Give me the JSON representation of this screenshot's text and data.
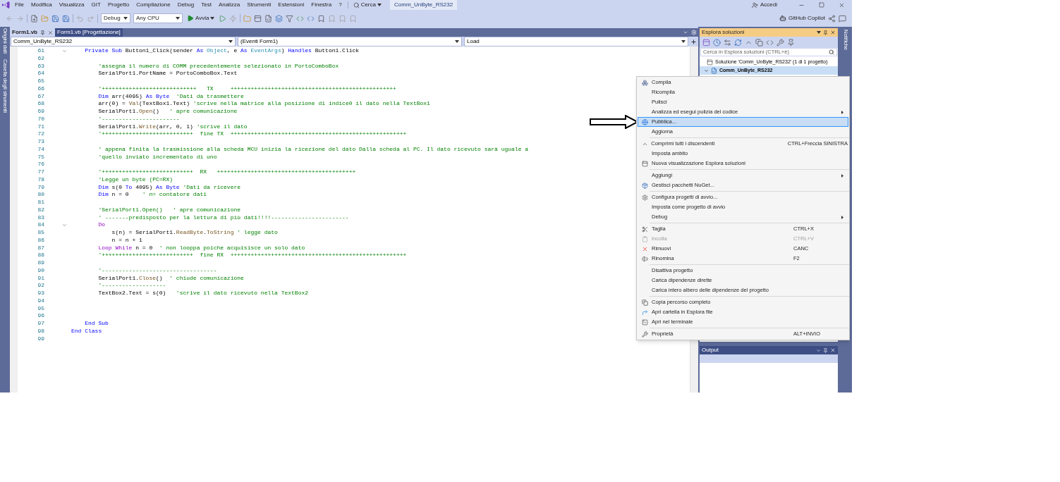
{
  "menu_bar": {
    "items": [
      "File",
      "Modifica",
      "Visualizza",
      "GIT",
      "Progetto",
      "Compilazione",
      "Debug",
      "Test",
      "Analizza",
      "Strumenti",
      "Estensioni",
      "Finestra",
      "?"
    ],
    "search": "Cerca",
    "title": "Comm_UnByte_RS232",
    "account": "Accedi"
  },
  "toolbar": {
    "configuration": "Debug",
    "platform": "Any CPU",
    "start": "Avvia",
    "copilot": "GitHub Copilot"
  },
  "side_tabs_left": [
    "Origini dati",
    "Casella degli strumenti"
  ],
  "side_tabs_right": [
    "Notifiche"
  ],
  "editor": {
    "tabs": [
      {
        "label": "Form1.vb",
        "selected": true
      },
      {
        "label": "Form1.vb [Progettazione]",
        "selected": false
      }
    ],
    "nav": {
      "project": "Comm_UnByte_RS232",
      "object": "(Eventi Form1)",
      "event": "Load"
    },
    "lines": [
      {
        "number": "61",
        "fold": true,
        "tokens": [
          {
            "kind": "keyword",
            "text": "    Private Sub "
          },
          {
            "kind": "plain",
            "text": "Button1_Click(sender "
          },
          {
            "kind": "keyword",
            "text": "As "
          },
          {
            "kind": "type",
            "text": "Object"
          },
          {
            "kind": "plain",
            "text": ", e "
          },
          {
            "kind": "keyword",
            "text": "As "
          },
          {
            "kind": "type",
            "text": "EventArgs"
          },
          {
            "kind": "plain",
            "text": ") "
          },
          {
            "kind": "keyword",
            "text": "Handles "
          },
          {
            "kind": "plain",
            "text": "Button1.Click"
          }
        ]
      },
      {
        "number": "62",
        "fold": false
      },
      {
        "number": "63",
        "fold": false,
        "tokens": [
          {
            "kind": "comment",
            "text": "        'assegna il numero di COMM precedentemente selezionato in PortoComboBox"
          }
        ]
      },
      {
        "number": "64",
        "fold": false,
        "tokens": [
          {
            "kind": "plain",
            "text": "        SerialPort1.PortName = PortoComboBox.Text"
          }
        ]
      },
      {
        "number": "65",
        "fold": false
      },
      {
        "number": "66",
        "fold": false,
        "tokens": [
          {
            "kind": "comment",
            "text": "        '++++++++++++++++++++++++++++   TX     +++++++++++++++++++++++++++++++++++++++++++++++++"
          }
        ]
      },
      {
        "number": "67",
        "fold": false,
        "tokens": [
          {
            "kind": "keyword",
            "text": "        Dim "
          },
          {
            "kind": "plain",
            "text": "arr(4095) "
          },
          {
            "kind": "keyword",
            "text": "As Byte "
          },
          {
            "kind": "comment",
            "text": " 'Dati da trasmettere"
          }
        ]
      },
      {
        "number": "68",
        "fold": false,
        "tokens": [
          {
            "kind": "plain",
            "text": "        arr(0) = "
          },
          {
            "kind": "method",
            "text": "Val"
          },
          {
            "kind": "plain",
            "text": "(TextBox1.Text) "
          },
          {
            "kind": "comment",
            "text": "'scrive nella matrice alla posizione di indice0 il dato nella TextBox1"
          }
        ]
      },
      {
        "number": "69",
        "fold": false,
        "tokens": [
          {
            "kind": "plain",
            "text": "        SerialPort1."
          },
          {
            "kind": "method",
            "text": "Open"
          },
          {
            "kind": "plain",
            "text": "()   "
          },
          {
            "kind": "comment",
            "text": "' apre comunicazione"
          }
        ]
      },
      {
        "number": "70",
        "fold": false,
        "tokens": [
          {
            "kind": "comment",
            "text": "        '-----------------------"
          }
        ]
      },
      {
        "number": "71",
        "fold": false,
        "tokens": [
          {
            "kind": "plain",
            "text": "        SerialPort1."
          },
          {
            "kind": "method",
            "text": "Write"
          },
          {
            "kind": "plain",
            "text": "(arr, 0, 1) "
          },
          {
            "kind": "comment",
            "text": "'scrive il dato"
          }
        ]
      },
      {
        "number": "72",
        "fold": false,
        "tokens": [
          {
            "kind": "comment",
            "text": "        '+++++++++++++++++++++++++++  fine TX  ++++++++++++++++++++++++++++++++++++++++++++++++++++"
          }
        ]
      },
      {
        "number": "73",
        "fold": false
      },
      {
        "number": "74",
        "fold": false,
        "tokens": [
          {
            "kind": "comment",
            "text": "        ' appena finita la trasmissione alla scheda MCU inizia la ricezione del dato Dalla scheda al PC. Il dato ricevuto sarà uguale a"
          }
        ]
      },
      {
        "number": "75",
        "fold": false,
        "tokens": [
          {
            "kind": "comment",
            "text": "        'quello inviato incrementato di uno"
          }
        ]
      },
      {
        "number": "76",
        "fold": false
      },
      {
        "number": "77",
        "fold": false,
        "tokens": [
          {
            "kind": "comment",
            "text": "        '+++++++++++++++++++++++++++  RX   +++++++++++++++++++++++++++++++++++++++++"
          }
        ]
      },
      {
        "number": "78",
        "fold": false,
        "tokens": [
          {
            "kind": "comment",
            "text": "        'Legge un byte (PC=RX)"
          }
        ]
      },
      {
        "number": "79",
        "fold": false,
        "tokens": [
          {
            "kind": "keyword",
            "text": "        Dim "
          },
          {
            "kind": "plain",
            "text": "s(0 "
          },
          {
            "kind": "keyword",
            "text": "To "
          },
          {
            "kind": "plain",
            "text": "4095) "
          },
          {
            "kind": "keyword",
            "text": "As Byte "
          },
          {
            "kind": "comment",
            "text": "'Dati da ricevere"
          }
        ]
      },
      {
        "number": "80",
        "fold": false,
        "tokens": [
          {
            "kind": "keyword",
            "text": "        Dim "
          },
          {
            "kind": "plain",
            "text": "n = 0    "
          },
          {
            "kind": "comment",
            "text": "' n= contatore dati"
          }
        ]
      },
      {
        "number": "81",
        "fold": false
      },
      {
        "number": "82",
        "fold": false,
        "tokens": [
          {
            "kind": "comment",
            "text": "        'SerialPort1.Open()   ' apre comunicazione"
          }
        ]
      },
      {
        "number": "83",
        "fold": false,
        "tokens": [
          {
            "kind": "comment",
            "text": "        ' -------predisposto per la lettura di più dati!!!!-----------------------"
          }
        ]
      },
      {
        "number": "84",
        "fold": true,
        "tokens": [
          {
            "kind": "control",
            "text": "        Do"
          }
        ]
      },
      {
        "number": "85",
        "fold": false,
        "tokens": [
          {
            "kind": "plain",
            "text": "            s(n) = SerialPort1."
          },
          {
            "kind": "method",
            "text": "ReadByte"
          },
          {
            "kind": "plain",
            "text": "."
          },
          {
            "kind": "method",
            "text": "ToString"
          },
          {
            "kind": "comment",
            "text": " ' legge dato"
          }
        ]
      },
      {
        "number": "86",
        "fold": false,
        "tokens": [
          {
            "kind": "plain",
            "text": "            n = n + 1"
          }
        ]
      },
      {
        "number": "87",
        "fold": false,
        "tokens": [
          {
            "kind": "control",
            "text": "        Loop While"
          },
          {
            "kind": "plain",
            "text": " n = 0  "
          },
          {
            "kind": "comment",
            "text": "' non looppa poiche acquisisce un solo dato"
          }
        ]
      },
      {
        "number": "88",
        "fold": false,
        "tokens": [
          {
            "kind": "comment",
            "text": "        '+++++++++++++++++++++++++++  fine RX  ++++++++++++++++++++++++++++++++++++++++++++++++++++"
          }
        ]
      },
      {
        "number": "89",
        "fold": false
      },
      {
        "number": "90",
        "fold": false,
        "tokens": [
          {
            "kind": "comment",
            "text": "        '----------------------------------"
          }
        ]
      },
      {
        "number": "91",
        "fold": false,
        "tokens": [
          {
            "kind": "plain",
            "text": "        SerialPort1."
          },
          {
            "kind": "method",
            "text": "Close"
          },
          {
            "kind": "plain",
            "text": "()  "
          },
          {
            "kind": "comment",
            "text": "' chiude comunicazione"
          }
        ]
      },
      {
        "number": "92",
        "fold": false,
        "tokens": [
          {
            "kind": "comment",
            "text": "        '-------------------"
          }
        ]
      },
      {
        "number": "93",
        "fold": false,
        "tokens": [
          {
            "kind": "plain",
            "text": "        TextBox2.Text = s(0)   "
          },
          {
            "kind": "comment",
            "text": "'scrive il dato ricevuto nella TextBox2"
          }
        ]
      },
      {
        "number": "94",
        "fold": false
      },
      {
        "number": "95",
        "fold": false
      },
      {
        "number": "96",
        "fold": false
      },
      {
        "number": "97",
        "fold": false,
        "tokens": [
          {
            "kind": "keyword",
            "text": "    End Sub"
          }
        ]
      },
      {
        "number": "98",
        "fold": false,
        "tokens": [
          {
            "kind": "keyword",
            "text": "End Class"
          }
        ]
      },
      {
        "number": "99",
        "fold": false
      }
    ]
  },
  "solution_explorer": {
    "title": "Esplora soluzioni",
    "search": {
      "placeholder": "Cerca in Esplora soluzioni (CTRL+è)"
    },
    "tree": [
      {
        "label": "Soluzione 'Comm_UnByte_RS232' (1 di 1 progetto)",
        "selected": false,
        "children": [
          {
            "label": "Comm_UnByte_RS232",
            "selected": true,
            "expanded": true
          }
        ]
      }
    ]
  },
  "output": {
    "title": "Output"
  },
  "context_menu": {
    "items": [
      {
        "kind": "item",
        "label": "Compila",
        "selected": false,
        "disabled": false,
        "submenu": false
      },
      {
        "kind": "item",
        "label": "Ricompila",
        "selected": false,
        "disabled": false,
        "submenu": false
      },
      {
        "kind": "item",
        "label": "Pulisci",
        "selected": false,
        "disabled": false,
        "submenu": false
      },
      {
        "kind": "item",
        "label": "Analizza ed esegui pulizia del codice",
        "selected": false,
        "disabled": false,
        "submenu": true
      },
      {
        "kind": "item",
        "label": "Pubblica...",
        "selected": true,
        "disabled": false,
        "submenu": false
      },
      {
        "kind": "item",
        "label": "Aggiorna",
        "selected": false,
        "disabled": false,
        "submenu": false
      },
      {
        "kind": "separator"
      },
      {
        "kind": "item",
        "label": "Comprimi tutti i discendenti",
        "shortcut": "CTRL+Freccia SINISTRA",
        "selected": false,
        "disabled": false,
        "submenu": false
      },
      {
        "kind": "item",
        "label": "Imposta ambito",
        "selected": false,
        "disabled": false,
        "submenu": false
      },
      {
        "kind": "item",
        "label": "Nuova visualizzazione Esplora soluzioni",
        "selected": false,
        "disabled": false,
        "submenu": false
      },
      {
        "kind": "separator"
      },
      {
        "kind": "item",
        "label": "Aggiungi",
        "selected": false,
        "disabled": false,
        "submenu": true
      },
      {
        "kind": "item",
        "label": "Gestisci pacchetti NuGet...",
        "selected": false,
        "disabled": false,
        "submenu": false
      },
      {
        "kind": "separator"
      },
      {
        "kind": "item",
        "label": "Configura progetti di avvio...",
        "selected": false,
        "disabled": false,
        "submenu": false
      },
      {
        "kind": "item",
        "label": "Imposta come progetto di avvio",
        "selected": false,
        "disabled": false,
        "submenu": false
      },
      {
        "kind": "item",
        "label": "Debug",
        "selected": false,
        "disabled": false,
        "submenu": true
      },
      {
        "kind": "separator"
      },
      {
        "kind": "item",
        "label": "Taglia",
        "shortcut": "CTRL+X",
        "selected": false,
        "disabled": false,
        "submenu": false
      },
      {
        "kind": "item",
        "label": "Incolla",
        "shortcut": "CTRL+V",
        "selected": false,
        "disabled": true,
        "submenu": false
      },
      {
        "kind": "item",
        "label": "Rimuovi",
        "shortcut": "CANC",
        "selected": false,
        "disabled": false,
        "submenu": false
      },
      {
        "kind": "item",
        "label": "Rinomina",
        "shortcut": "F2",
        "selected": false,
        "disabled": false,
        "submenu": false
      },
      {
        "kind": "separator"
      },
      {
        "kind": "item",
        "label": "Disattiva progetto",
        "selected": false,
        "disabled": false,
        "submenu": false
      },
      {
        "kind": "item",
        "label": "Carica dipendenze dirette",
        "selected": false,
        "disabled": false,
        "submenu": false
      },
      {
        "kind": "item",
        "label": "Carica intero albero delle dipendenze del progetto",
        "selected": false,
        "disabled": false,
        "submenu": false
      },
      {
        "kind": "separator"
      },
      {
        "kind": "item",
        "label": "Copia percorso completo",
        "selected": false,
        "disabled": false,
        "submenu": false
      },
      {
        "kind": "item",
        "label": "Apri cartella in Esplora file",
        "selected": false,
        "disabled": false,
        "submenu": false
      },
      {
        "kind": "item",
        "label": "Apri nel terminale",
        "selected": false,
        "disabled": false,
        "submenu": false
      },
      {
        "kind": "separator"
      },
      {
        "kind": "item",
        "label": "Proprietà",
        "shortcut": "ALT+INVIO",
        "selected": false,
        "disabled": false,
        "submenu": false
      }
    ]
  }
}
